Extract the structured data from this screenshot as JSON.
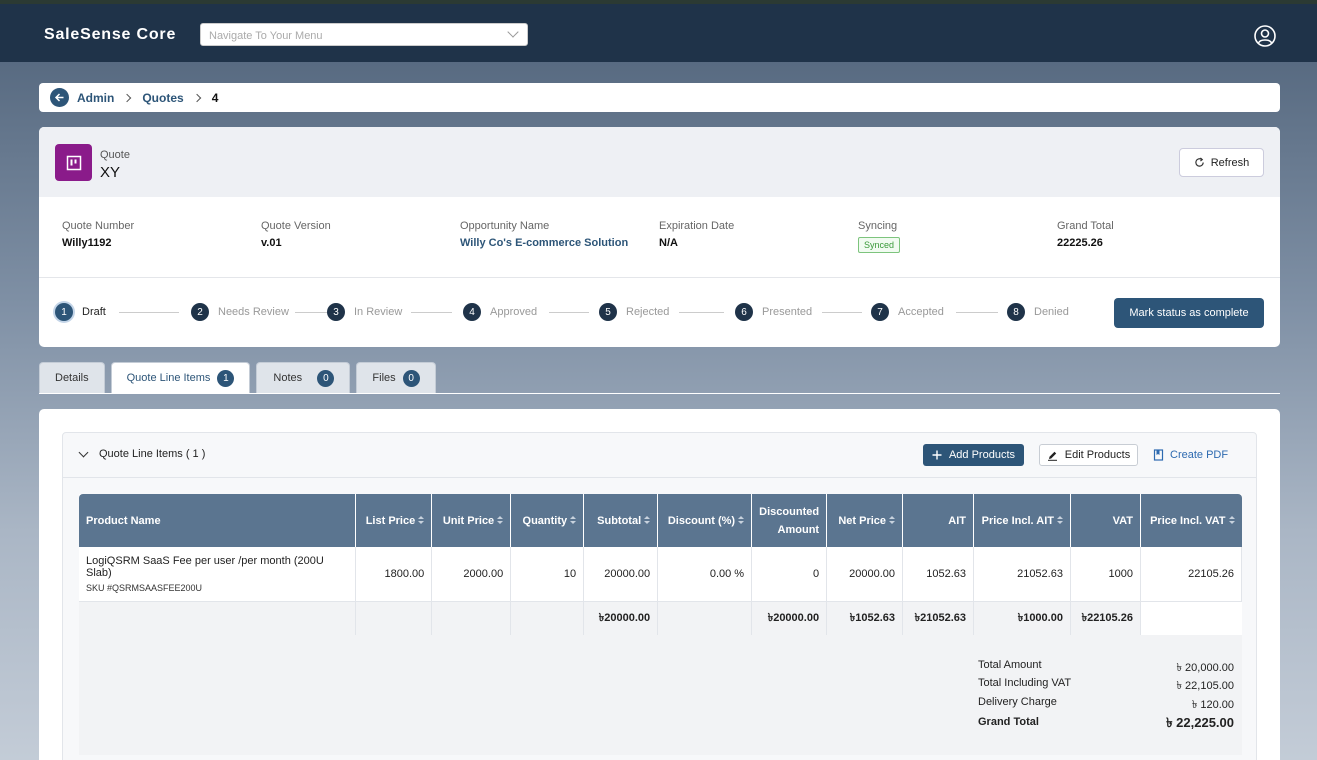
{
  "app": {
    "name": "SaleSense Core",
    "nav_placeholder": "Navigate To Your Menu"
  },
  "breadcrumb": {
    "items": [
      "Admin",
      "Quotes"
    ],
    "current": "4"
  },
  "record": {
    "object_label": "Quote",
    "name": "XY",
    "refresh_label": "Refresh",
    "fields": [
      {
        "label": "Quote Number",
        "value": "Willy1192"
      },
      {
        "label": "Quote Version",
        "value": "v.01"
      },
      {
        "label": "Opportunity Name",
        "value": "Willy Co's E-commerce Solution"
      },
      {
        "label": "Expiration Date",
        "value": "N/A"
      },
      {
        "label": "Syncing",
        "value": "Synced"
      },
      {
        "label": "Grand Total",
        "value": "22225.26"
      }
    ]
  },
  "status_path": {
    "steps": [
      {
        "num": "1",
        "label": "Draft"
      },
      {
        "num": "2",
        "label": "Needs Review"
      },
      {
        "num": "3",
        "label": "In Review"
      },
      {
        "num": "4",
        "label": "Approved"
      },
      {
        "num": "5",
        "label": "Rejected"
      },
      {
        "num": "6",
        "label": "Presented"
      },
      {
        "num": "7",
        "label": "Accepted"
      },
      {
        "num": "8",
        "label": "Denied"
      }
    ],
    "active_step": "1",
    "action_label": "Mark status as complete"
  },
  "tabs": [
    {
      "label": "Details",
      "count": null
    },
    {
      "label": "Quote Line Items",
      "count": "1"
    },
    {
      "label": "Notes",
      "count": "0"
    },
    {
      "label": "Files",
      "count": "0"
    }
  ],
  "active_tab": "Quote Line Items",
  "line_items": {
    "title": "Quote Line Items ( 1 )",
    "add_label": "Add Products",
    "edit_label": "Edit Products",
    "pdf_label": "Create PDF",
    "columns": [
      "Product Name",
      "List Price",
      "Unit Price",
      "Quantity",
      "Subtotal",
      "Discount (%)",
      "Discounted Amount",
      "Net Price",
      "AIT",
      "Price Incl. AIT",
      "VAT",
      "Price Incl. VAT"
    ],
    "rows": [
      {
        "product": "LogiQSRM SaaS Fee per user /per month (200U Slab)",
        "sku": "SKU #QSRMSAASFEE200U",
        "list_price": "1800.00",
        "unit_price": "2000.00",
        "quantity": "10",
        "subtotal": "20000.00",
        "discount": "0.00 %",
        "discounted_amount": "0",
        "net_price": "20000.00",
        "ait": "1052.63",
        "price_incl_ait": "21052.63",
        "vat": "1000",
        "price_incl_vat": "22105.26"
      }
    ],
    "totals": {
      "subtotal": "৳20000.00",
      "discounted_amount": "৳20000.00",
      "net_price": "৳1052.63",
      "ait": "৳21052.63",
      "price_incl_ait": "৳1000.00",
      "vat": "৳22105.26"
    }
  },
  "summary": [
    {
      "label": "Total Amount",
      "value": "৳ 20,000.00"
    },
    {
      "label": "Total Including VAT",
      "value": "৳ 22,105.00"
    },
    {
      "label": "Delivery Charge",
      "value": "৳ 120.00"
    },
    {
      "label": "Grand Total",
      "value": "৳ 22,225.00"
    }
  ],
  "colors": {
    "topbar": "#1f3349",
    "accent": "#2d5578",
    "quote_icon": "#8a1b8a",
    "table_header": "#5b7590",
    "synced": "#3a9a3a"
  }
}
